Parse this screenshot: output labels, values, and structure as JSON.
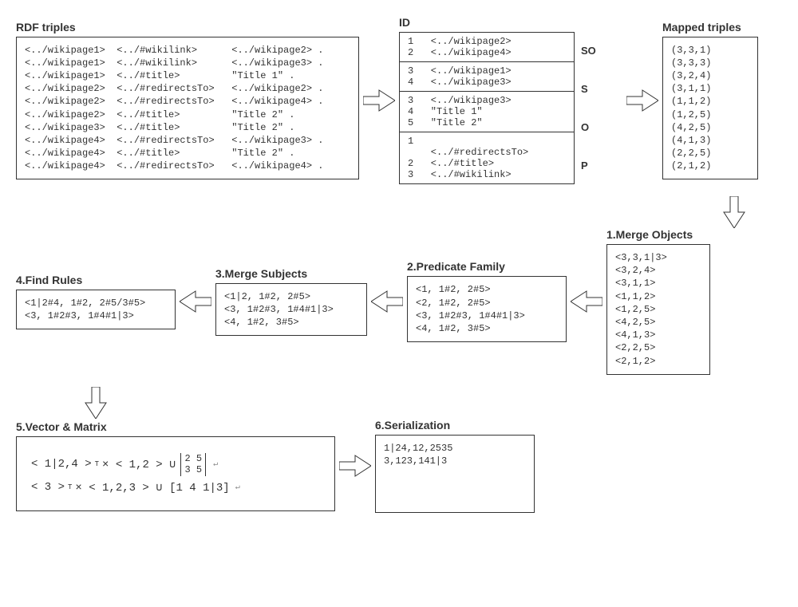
{
  "rdf": {
    "title": "RDF triples",
    "body": "<../wikipage1>  <../#wikilink>      <../wikipage2> .\n<../wikipage1>  <../#wikilink>      <../wikipage3> .\n<../wikipage1>  <../#title>         \"Title 1\" .\n<../wikipage2>  <../#redirectsTo>   <../wikipage2> .\n<../wikipage2>  <../#redirectsTo>   <../wikipage4> .\n<../wikipage2>  <../#title>         \"Title 2\" .\n<../wikipage3>  <../#title>         \"Title 2\" .\n<../wikipage4>  <../#redirectsTo>   <../wikipage3> .\n<../wikipage4>  <../#title>         \"Title 2\" .\n<../wikipage4>  <../#redirectsTo>   <../wikipage4> ."
  },
  "id": {
    "title": "ID",
    "so_lines": "1   <../wikipage2>\n2   <../wikipage4>",
    "so_label": "SO",
    "s_lines": "3   <../wikipage1>\n4   <../wikipage3>",
    "s_label": "S",
    "o_lines": "3   <../wikipage3>\n4   \"Title 1\"\n5   \"Title 2\"",
    "o_label": "O",
    "p_lines": "1\n    <../#redirectsTo>\n2   <../#title>\n3   <../#wikilink>",
    "p_label": "P"
  },
  "mapped": {
    "title": "Mapped triples",
    "body": "(3,3,1)\n(3,3,3)\n(3,2,4)\n(3,1,1)\n(1,1,2)\n(1,2,5)\n(4,2,5)\n(4,1,3)\n(2,2,5)\n(2,1,2)"
  },
  "merge_objects": {
    "title": "1.Merge Objects",
    "body": "<3,3,1|3>\n<3,2,4>\n<3,1,1>\n<1,1,2>\n<1,2,5>\n<4,2,5>\n<4,1,3>\n<2,2,5>\n<2,1,2>"
  },
  "predicate_family": {
    "title": "2.Predicate Family",
    "body": "<1, 1#2, 2#5>\n<2, 1#2, 2#5>\n<3, 1#2#3, 1#4#1|3>\n<4, 1#2, 3#5>"
  },
  "merge_subjects": {
    "title": "3.Merge Subjects",
    "body": "<1|2, 1#2, 2#5>\n<3, 1#2#3, 1#4#1|3>\n<4, 1#2, 3#5>"
  },
  "find_rules": {
    "title": "4.Find Rules",
    "body": "<1|2#4, 1#2, 2#5/3#5>\n<3, 1#2#3, 1#4#1|3>"
  },
  "vector_matrix": {
    "title": "5.Vector & Matrix",
    "line1_a": "< 1|2,4 >",
    "line1_b": " × < 1,2 > ∪ ",
    "line1_matrix_top": "2   5",
    "line1_matrix_bot": "3   5",
    "line2_a": "< 3 >",
    "line2_b": " × < 1,2,3 > ∪ [1  4  1|3]"
  },
  "serialization": {
    "title": "6.Serialization",
    "body": "1|24,12,2535\n3,123,141|3"
  }
}
